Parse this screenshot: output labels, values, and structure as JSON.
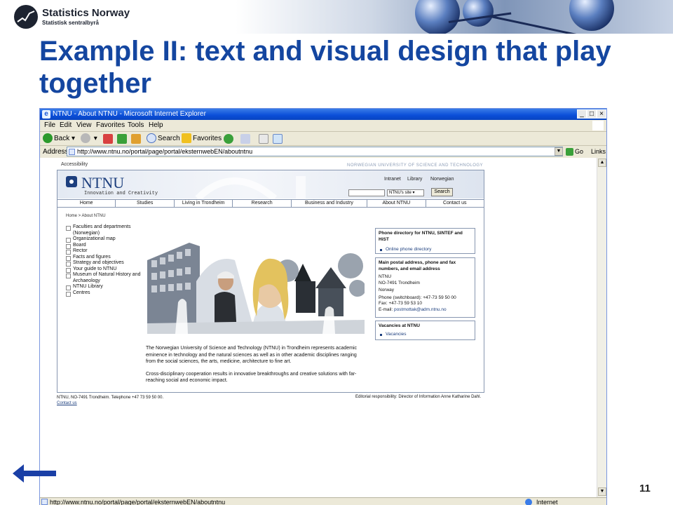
{
  "brand": {
    "name": "Statistics Norway",
    "subtitle": "Statistisk sentralbyrå"
  },
  "slide": {
    "title": "Example II: text and visual design that play together",
    "number": "11"
  },
  "browser": {
    "window_title": "NTNU - About NTNU - Microsoft Internet Explorer",
    "menu": [
      "File",
      "Edit",
      "View",
      "Favorites",
      "Tools",
      "Help"
    ],
    "toolbar": {
      "back": "Back",
      "search": "Search",
      "favorites": "Favorites"
    },
    "address_label": "Address",
    "url": "http://www.ntnu.no/portal/page/portal/eksternwebEN/aboutntnu",
    "go": "Go",
    "links": "Links",
    "status_text": "http://www.ntnu.no/portal/page/portal/eksternwebEN/aboutntnu",
    "zone": "Internet"
  },
  "site": {
    "accessibility": "Accessibility",
    "university": "NORWEGIAN UNIVERSITY OF SCIENCE AND TECHNOLOGY",
    "logo": "NTNU",
    "tagline": "Innovation and Creativity",
    "utility_links": [
      "Intranet",
      "Library",
      "Norwegian"
    ],
    "search_scope": "NTNU's site",
    "search_button": "Search",
    "nav": [
      "Home",
      "Studies",
      "Living in Trondheim",
      "Research",
      "Business and Industry",
      "About NTNU",
      "Contact us"
    ],
    "breadcrumb": "Home > About NTNU",
    "left_nav": [
      "Faculties and departments (Norwegian)",
      "Organizational map",
      "Board",
      "Rector",
      "Facts and figures",
      "Strategy and objectives",
      "Your guide to NTNU",
      "Museum of Natural History and Archaeology",
      "NTNU Library",
      "Centres"
    ],
    "about_p1": "The Norwegian University of Science and Technology (NTNU) in Trondheim represents academic eminence in technology and the natural sciences as well as in other academic disciplines ranging from the social sciences, the arts, medicine, architecture to fine art.",
    "about_p2": "Cross-disciplinary cooperation results in innovative breakthroughs and creative solutions with far-reaching social and economic impact.",
    "phone_box": {
      "title": "Phone directory for NTNU, SINTEF and HiST",
      "link": "Online phone directory"
    },
    "address_box": {
      "title": "Main postal address, phone and fax numbers, and email address",
      "line1": "NTNU",
      "line2": "NO-7491 Trondheim",
      "line3": "Norway",
      "phone": "Phone (switchboard): +47-73 59 50 00",
      "fax": "Fax: +47-73 59 53 10",
      "email_label": "E-mail:",
      "email": "postmottak@adm.ntnu.no"
    },
    "vacancies_box": {
      "title": "Vacancies at NTNU",
      "link": "Vacancies"
    },
    "footer_left": "NTNU, NO-7491 Trondheim. Telephone +47 73 59 50 00.",
    "footer_contact": "Contact us",
    "footer_right": "Editorial responsibility: Director of Information Anne Katharine Dahl."
  },
  "colors": {
    "title": "#1446a0",
    "ntnu_blue": "#1d3f7e",
    "arrow": "#1a3fa6"
  }
}
